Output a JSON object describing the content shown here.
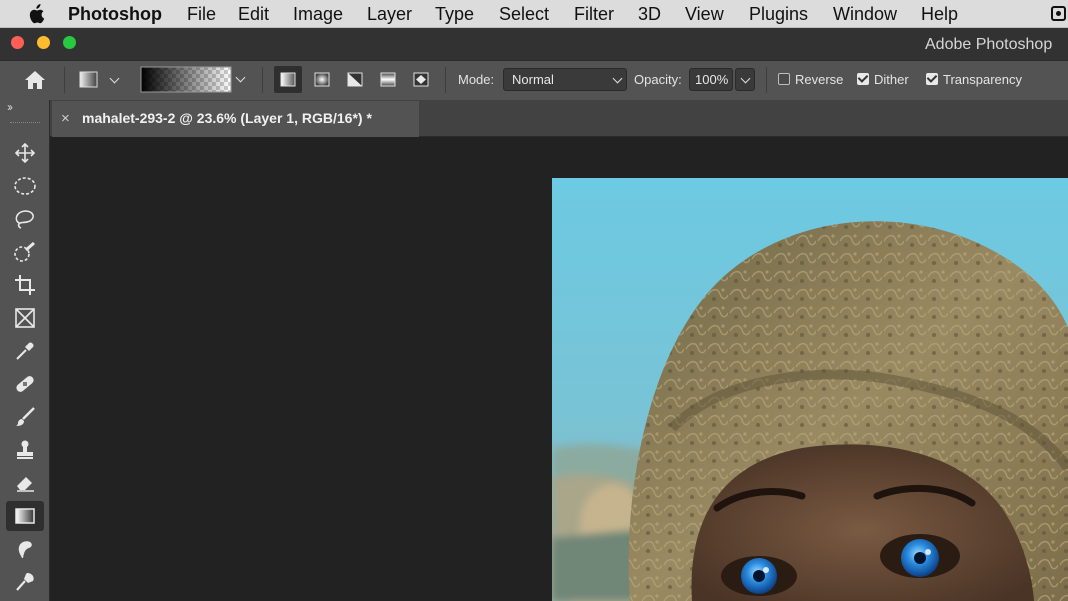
{
  "menubar": {
    "apple_icon": "apple-icon",
    "app_name": "Photoshop",
    "items": [
      "File",
      "Edit",
      "Image",
      "Layer",
      "Type",
      "Select",
      "Filter",
      "3D",
      "View",
      "Plugins",
      "Window",
      "Help"
    ]
  },
  "window": {
    "title": "Adobe Photoshop",
    "traffic_lights": {
      "close": "#ff5f57",
      "minimize": "#febc2e",
      "maximize": "#28c840"
    }
  },
  "options": {
    "mode_label": "Mode:",
    "mode_value": "Normal",
    "opacity_label": "Opacity:",
    "opacity_value": "100%",
    "reverse_label": "Reverse",
    "reverse_checked": false,
    "dither_label": "Dither",
    "dither_checked": true,
    "transparency_label": "Transparency",
    "transparency_checked": true,
    "gradient_types": [
      "linear-gradient-icon",
      "radial-gradient-icon",
      "angle-gradient-icon",
      "reflected-gradient-icon",
      "diamond-gradient-icon"
    ]
  },
  "toolbar": {
    "tools": [
      "move-icon",
      "marquee-icon",
      "lasso-icon",
      "quick-selection-icon",
      "crop-icon",
      "frame-icon",
      "eyedropper-icon",
      "healing-brush-icon",
      "brush-icon",
      "clone-stamp-icon",
      "eraser-icon",
      "gradient-icon",
      "smudge-icon",
      "pen-icon"
    ],
    "active_tool": "gradient-icon"
  },
  "document": {
    "tab_title": "mahalet-293-2 @ 23.6% (Layer 1, RGB/16*) *",
    "close_glyph": "×"
  },
  "colors": {
    "panel": "#535353",
    "canvas_bg": "#222222",
    "sky": "#6cc4dc",
    "scarf": "#8a7a52",
    "eyes": "#2a8ce0"
  }
}
